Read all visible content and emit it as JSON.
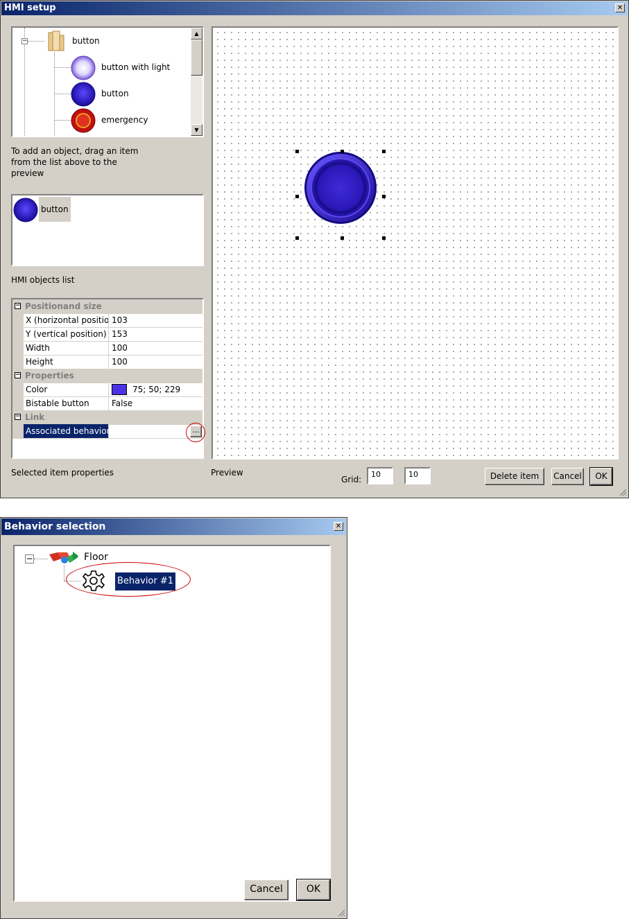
{
  "hmi_window": {
    "title": "HMI setup",
    "close_glyph": "✕",
    "palette": {
      "items": [
        {
          "label": "button",
          "icon": "folder-icon"
        },
        {
          "label": "button with light",
          "icon": "light-button-icon"
        },
        {
          "label": "button",
          "icon": "blue-button-icon"
        },
        {
          "label": "emergency",
          "icon": "emergency-button-icon"
        }
      ]
    },
    "hint": "To add an object, drag an item from the list above to the preview",
    "objects_list": {
      "items": [
        {
          "label": "button"
        }
      ],
      "caption": "HMI objects list"
    },
    "properties": {
      "categories": [
        {
          "name": "Positionand size"
        },
        {
          "name": "Properties"
        },
        {
          "name": "Link"
        }
      ],
      "rows": {
        "x": {
          "name": "X (horizontal position",
          "value": "103"
        },
        "y": {
          "name": "Y (vertical position)",
          "value": "153"
        },
        "width": {
          "name": "Width",
          "value": "100"
        },
        "height": {
          "name": "Height",
          "value": "100"
        },
        "color": {
          "name": "Color",
          "value": "75; 50; 229",
          "swatch": "#4b32e5"
        },
        "bistable": {
          "name": "Bistable button",
          "value": "False"
        },
        "behavior": {
          "name": "Associated behavior",
          "value": "",
          "ellipsis": "..."
        }
      },
      "caption": "Selected item properties"
    },
    "preview_caption": "Preview",
    "grid": {
      "label": "Grid:",
      "x": "10",
      "y": "10"
    },
    "buttons": {
      "delete": "Delete item",
      "cancel": "Cancel",
      "ok": "OK"
    }
  },
  "behavior_window": {
    "title": "Behavior selection",
    "close_glyph": "✕",
    "tree": {
      "root": {
        "label": "Floor",
        "icon": "floor-icon"
      },
      "child": {
        "label": "Behavior #1",
        "icon": "gear-icon"
      }
    },
    "buttons": {
      "cancel": "Cancel",
      "ok": "OK"
    }
  },
  "colors": {
    "selection": "#0a246a",
    "highlight_circle": "#cc0000",
    "button_blue": "#4b32e5"
  }
}
